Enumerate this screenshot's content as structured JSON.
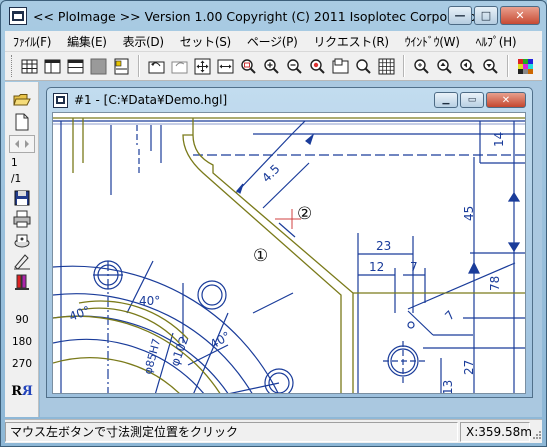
{
  "app": {
    "title": "<< PloImage >>  Version 1.00 Copyright (C) 2011 Isoplotec Corporation",
    "minimize": "—",
    "maximize": "□",
    "close": "✕"
  },
  "menu": [
    {
      "label": "ﾌｧｲﾙ(F)",
      "name": "menu-file"
    },
    {
      "label": "編集(E)",
      "name": "menu-edit"
    },
    {
      "label": "表示(D)",
      "name": "menu-view"
    },
    {
      "label": "セット(S)",
      "name": "menu-set"
    },
    {
      "label": "ページ(P)",
      "name": "menu-page"
    },
    {
      "label": "リクエスト(R)",
      "name": "menu-request"
    },
    {
      "label": "ｳｲﾝﾄﾞｳ(W)",
      "name": "menu-window"
    },
    {
      "label": "ﾍﾙﾌﾟ(H)",
      "name": "menu-help"
    }
  ],
  "lefttool": {
    "page_current": "1",
    "page_total": "/1",
    "rot90": "90",
    "rot180": "180",
    "rot270": "270",
    "mirror": "R"
  },
  "child": {
    "title": "#1 - [C:¥Data¥Demo.hgl]",
    "min": "▁",
    "restore": "▭",
    "close": "✕"
  },
  "drawing": {
    "dims": [
      "14",
      "45",
      "78",
      "23",
      "12",
      "7",
      "4.5",
      "7",
      "27",
      "13",
      "40°",
      "40°",
      "40°",
      "φ102",
      "φ85H7"
    ],
    "marker1": "①",
    "marker2": "②"
  },
  "status": {
    "message": "マウス左ボタンで寸法測定位置をクリック",
    "coord": "X:359.58m"
  },
  "colors": {
    "drawing_blue": "#1a3c9a",
    "drawing_olive": "#7a7a1a",
    "cursor_red": "#d04040"
  }
}
